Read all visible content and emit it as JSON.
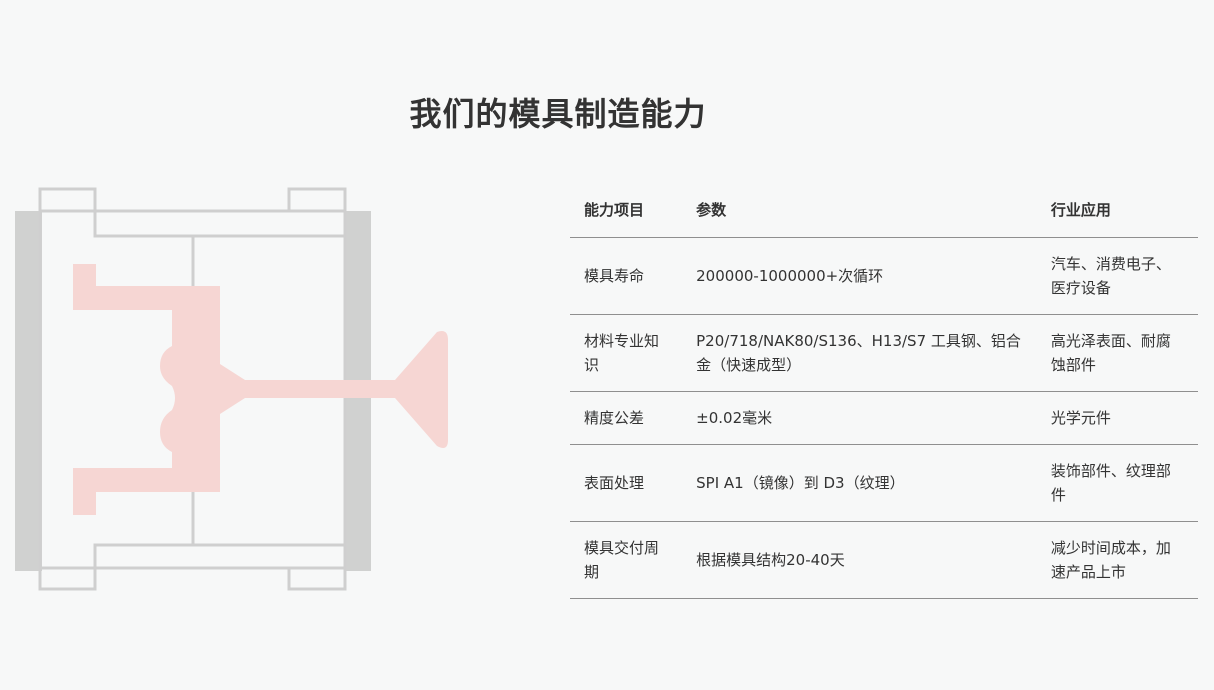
{
  "title": "我们的模具制造能力",
  "colors": {
    "background": "#f7f8f8",
    "mold_frame_gray": "#d0d1d0",
    "mold_outline": "#cfcfcf",
    "part_pink": "#f6d6d3",
    "divider": "#8f8f8f"
  },
  "table": {
    "headers": [
      "能力项目",
      "参数",
      "行业应用"
    ],
    "rows": [
      {
        "item": "模具寿命",
        "param": "200000-1000000+次循环",
        "app": "汽车、消费电子、医疗设备"
      },
      {
        "item": "材料专业知识",
        "param": "P20/718/NAK80/S136、H13/S7 工具钢、铝合金（快速成型）",
        "app": "高光泽表面、耐腐蚀部件"
      },
      {
        "item": "精度公差",
        "param": "±0.02毫米",
        "app": "光学元件"
      },
      {
        "item": "表面处理",
        "param": "SPI A1（镜像）到 D3（纹理）",
        "app": "装饰部件、纹理部件"
      },
      {
        "item": "模具交付周期",
        "param": "根据模具结构20-40天",
        "app": "减少时间成本，加速产品上市"
      }
    ]
  }
}
